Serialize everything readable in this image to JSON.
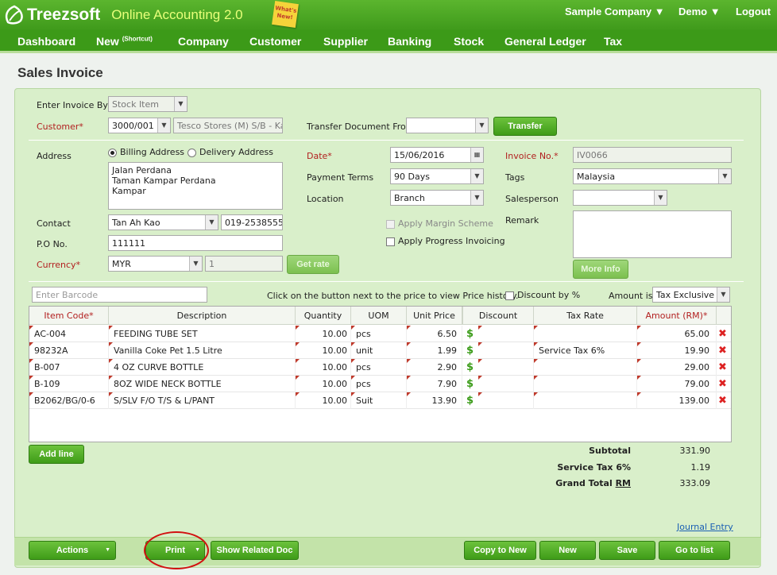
{
  "app": {
    "brand": "Treezsoft",
    "tagline": "Online Accounting 2.0",
    "whatsnew": "What's New!",
    "company": "Sample Company",
    "user": "Demo",
    "logout": "Logout"
  },
  "nav": [
    {
      "label": "Dashboard"
    },
    {
      "label": "New",
      "sup": "(Shortcut)"
    },
    {
      "label": "Company"
    },
    {
      "label": "Customer"
    },
    {
      "label": "Supplier"
    },
    {
      "label": "Banking"
    },
    {
      "label": "Stock"
    },
    {
      "label": "General Ledger"
    },
    {
      "label": "Tax"
    }
  ],
  "page": {
    "title": "Sales Invoice"
  },
  "form": {
    "enter_by_label": "Enter Invoice By",
    "enter_by_value": "Stock Item",
    "customer_label": "Customer*",
    "customer_code": "3000/001",
    "customer_name": "Tesco Stores (M) S/B - Kam",
    "transfer_label": "Transfer Document From",
    "transfer_value": "",
    "transfer_btn": "Transfer",
    "address_label": "Address",
    "billing": "Billing Address",
    "delivery": "Delivery Address",
    "address_lines": [
      "Jalan Perdana",
      "Taman Kampar Perdana",
      "Kampar"
    ],
    "contact_label": "Contact",
    "contact_name": "Tan Ah Kao",
    "contact_phone": "019-2538555",
    "po_label": "P.O No.",
    "po_value": "111111",
    "currency_label": "Currency*",
    "currency_value": "MYR",
    "rate_value": "1",
    "getrate_btn": "Get rate",
    "date_label": "Date*",
    "date_value": "15/06/2016",
    "terms_label": "Payment Terms",
    "terms_value": "90 Days",
    "location_label": "Location",
    "location_value": "Branch",
    "margin_label": "Apply Margin Scheme",
    "progress_label": "Apply Progress Invoicing",
    "invno_label": "Invoice No.*",
    "invno_value": "IV0066",
    "tags_label": "Tags",
    "tags_value": "Malaysia",
    "salesperson_label": "Salesperson",
    "salesperson_value": "",
    "remark_label": "Remark",
    "moreinfo_btn": "More Info",
    "barcode_placeholder": "Enter Barcode",
    "price_hint": "Click on the button next to the price to view Price history.",
    "discount_pct_label": "Discount by %",
    "amount_is_label": "Amount is:",
    "amount_is_value": "Tax Exclusive"
  },
  "table": {
    "headers": [
      "Item Code*",
      "Description",
      "Quantity",
      "UOM",
      "Unit Price",
      "Discount",
      "Tax Rate",
      "Amount (RM)*"
    ],
    "rows": [
      {
        "code": "AC-004",
        "desc": "FEEDING TUBE SET",
        "qty": "10.00",
        "uom": "pcs",
        "price": "6.50",
        "discount": "",
        "tax": "",
        "amount": "65.00"
      },
      {
        "code": "98232A",
        "desc": "Vanilla Coke Pet 1.5 Litre",
        "qty": "10.00",
        "uom": "unit",
        "price": "1.99",
        "discount": "",
        "tax": "Service Tax 6%",
        "amount": "19.90"
      },
      {
        "code": "B-007",
        "desc": "4 OZ CURVE BOTTLE",
        "qty": "10.00",
        "uom": "pcs",
        "price": "2.90",
        "discount": "",
        "tax": "",
        "amount": "29.00"
      },
      {
        "code": "B-109",
        "desc": "8OZ WIDE NECK BOTTLE",
        "qty": "10.00",
        "uom": "pcs",
        "price": "7.90",
        "discount": "",
        "tax": "",
        "amount": "79.00"
      },
      {
        "code": "B2062/BG/0-6",
        "desc": "S/SLV F/O T/S & L/PANT",
        "qty": "10.00",
        "uom": "Suit",
        "price": "13.90",
        "discount": "",
        "tax": "",
        "amount": "139.00"
      }
    ]
  },
  "totals": {
    "subtotal_label": "Subtotal",
    "subtotal": "331.90",
    "tax_label": "Service Tax 6%",
    "tax": "1.19",
    "grand_label": "Grand Total",
    "grand_currency": "RM",
    "grand": "333.09"
  },
  "actions": {
    "addline": "Add line",
    "journal": "Journal Entry",
    "actions": "Actions",
    "print": "Print",
    "related": "Show Related Doc",
    "copy": "Copy to New",
    "new": "New",
    "save": "Save",
    "golist": "Go to list"
  },
  "colors": {
    "green": "#3c9a18",
    "required": "#b21f1f",
    "panel": "#d9efca",
    "annotation": "#d21010"
  }
}
